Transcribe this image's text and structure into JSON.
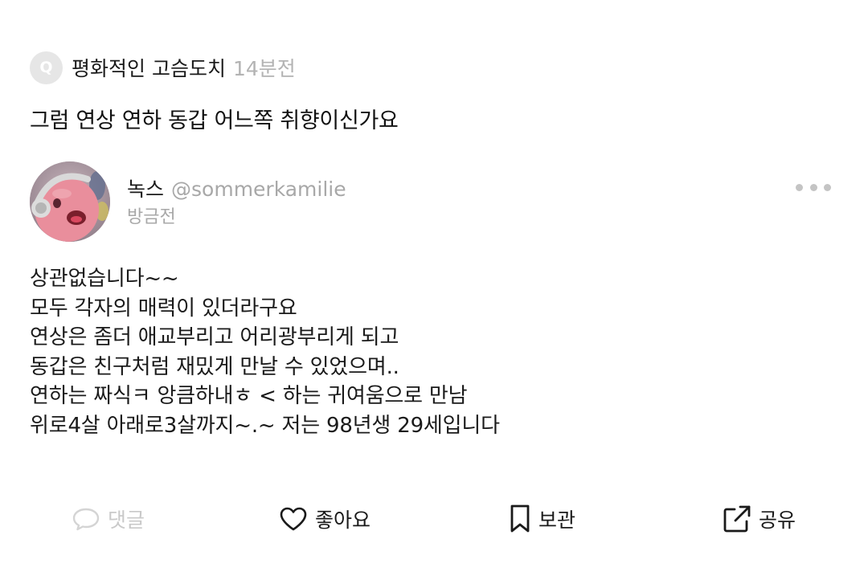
{
  "question": {
    "badge": "Q",
    "author": "평화적인 고슴도치",
    "time": "14분전",
    "text": "그럼 연상 연하 동갑 어느쪽 취향이신가요"
  },
  "answer": {
    "nickname": "녹스",
    "handle": "@sommerkamilie",
    "time": "방금전",
    "body_lines": [
      "상관없습니다~~",
      "모두 각자의 매력이 있더라구요",
      "연상은 좀더 애교부리고 어리광부리게 되고",
      "동갑은 친구처럼 재밌게 만날 수 있었으며..",
      "연하는 짜식ㅋ 앙큼하내ㅎ < 하는 귀여움으로 만남",
      "위로4살 아래로3살까지~.~ 저는 98년생 29세입니다"
    ]
  },
  "actions": {
    "comment": "댓글",
    "like": "좋아요",
    "save": "보관",
    "share": "공유"
  },
  "icons": {
    "more": "more-horizontal-icon",
    "comment": "speech-bubble-icon",
    "like": "heart-icon",
    "save": "bookmark-icon",
    "share": "external-share-icon"
  },
  "colors": {
    "muted": "#a8a8a8",
    "disabled": "#c9c9c9",
    "text": "#1a1a1a"
  }
}
